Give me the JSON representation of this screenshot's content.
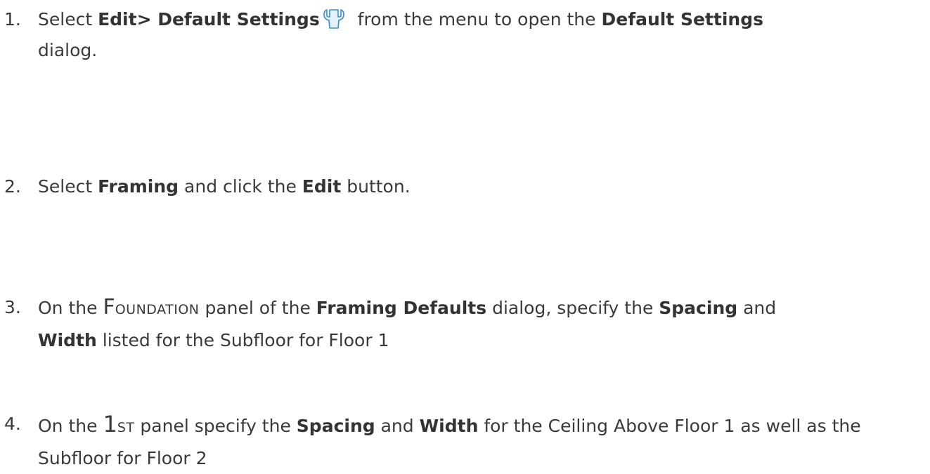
{
  "steps": [
    {
      "number": "1.",
      "parts": {
        "a": "Select ",
        "b1": "Edit> Default Settings",
        "icon": "wrench-icon",
        "c": " from the menu to open the ",
        "b2": "Default Settings",
        "d": "dialog."
      }
    },
    {
      "number": "2.",
      "parts": {
        "a": "Select ",
        "b1": "Framing",
        "c": " and click the ",
        "b2": "Edit",
        "d": " button."
      }
    },
    {
      "number": "3.",
      "parts": {
        "a": "On the ",
        "sc_first": "F",
        "sc_rest": "OUNDATION",
        "c": " panel of the ",
        "b1": "Framing Defaults",
        "d": " dialog, specify the ",
        "b2": "Spacing",
        "e": " and",
        "b3": "Width",
        "f": " listed for the Subfloor for Floor 1"
      }
    },
    {
      "number": "4.",
      "parts": {
        "a": "On the ",
        "sc_first": "1",
        "sc_rest": "ST",
        "c": " panel specify the ",
        "b1": "Spacing",
        "d": " and ",
        "b2": "Width",
        "e": " for the Ceiling Above Floor 1 as well as the Subfloor for Floor 2"
      }
    }
  ],
  "colors": {
    "text": "#3a3a3a",
    "icon_stroke": "#3d8fc7",
    "icon_fill": "#e3f1fb"
  }
}
